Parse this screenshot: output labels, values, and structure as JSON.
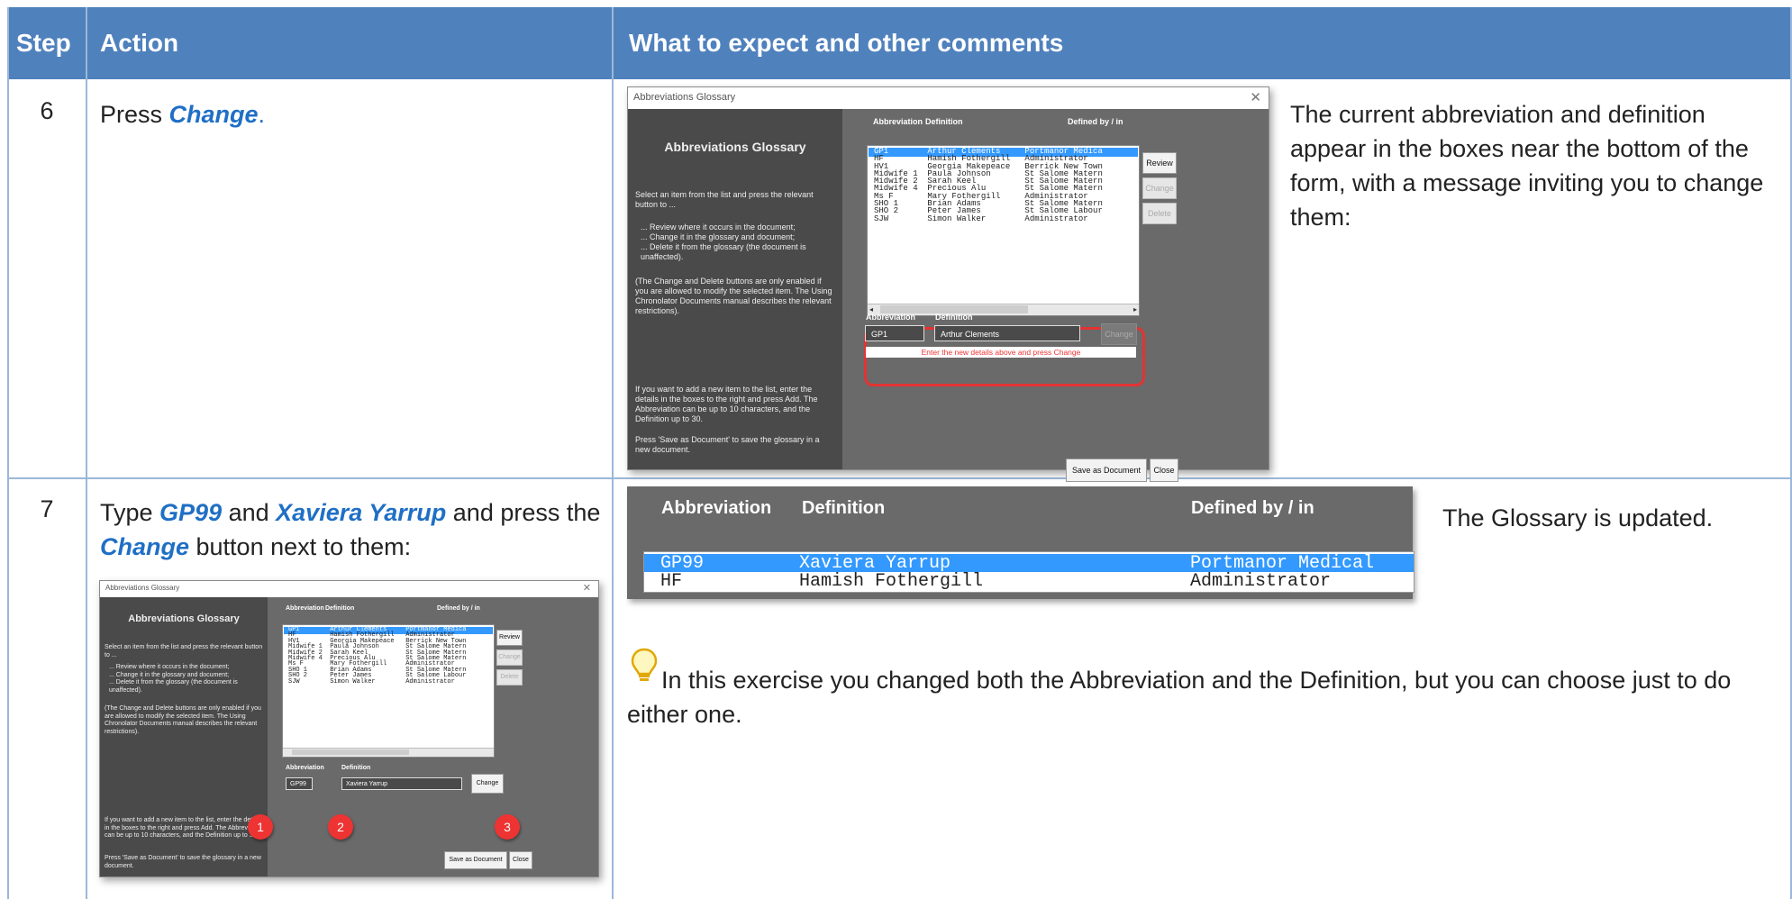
{
  "table": {
    "headers": {
      "step": "Step",
      "action": "Action",
      "expect": "What to expect and other comments"
    }
  },
  "rows": [
    {
      "step": "6",
      "action_pre": "Press ",
      "action_em": "Change",
      "action_post": ".",
      "comment": "The current abbreviation and definition appear in the boxes near the bottom of the form, with a message inviting you to change them:"
    },
    {
      "step": "7",
      "action_1": "Type ",
      "action_em1": "GP99",
      "action_2": " and ",
      "action_em2": "Xaviera Yarrup",
      "action_3": " and press the ",
      "action_em3": "Change",
      "action_4": " button next to them:",
      "comment": "The Glossary is updated.",
      "tip": "In this exercise you changed both the Abbreviation and the Definition, but you can choose just to do either one."
    }
  ],
  "dialog": {
    "window_title": "Abbreviations Glossary",
    "heading": "Abbreviations Glossary",
    "intro": "Select an item from the list and press the relevant button to ...",
    "bullets": [
      "... Review where it occurs in the document;",
      "... Change it in the glossary and document;",
      "... Delete it from the glossary (the document is unaffected)."
    ],
    "note": "(The Change and Delete buttons are only enabled if you are allowed to modify the selected item. The Using Chronolator Documents manual describes the relevant restrictions).",
    "add_help": "If you want to add a new item to the list, enter the details in the boxes to the right and press Add. The Abbreviation can be up to 10 characters, and the Definition up to 30.",
    "save_help": "Press 'Save as Document' to save the glossary in a new document.",
    "col_abbrev": "Abbreviation",
    "col_def": "Definition",
    "col_defined": "Defined by / in",
    "btn_review": "Review",
    "btn_change": "Change",
    "btn_delete": "Delete",
    "btn_save": "Save as Document",
    "btn_close": "Close",
    "entries": [
      {
        "abbr": "GP1",
        "def": "Arthur Clements",
        "by": "Portmanor Medica"
      },
      {
        "abbr": "HF",
        "def": "Hamish Fothergill",
        "by": "Administrator"
      },
      {
        "abbr": "HV1",
        "def": "Georgia Makepeace",
        "by": "Berrick New Town"
      },
      {
        "abbr": "Midwife 1",
        "def": "Paula Johnson",
        "by": "St Salome Matern"
      },
      {
        "abbr": "Midwife 2",
        "def": "Sarah Keel",
        "by": "St Salome Matern"
      },
      {
        "abbr": "Midwife 4",
        "def": "Precious Alu",
        "by": "St Salome Matern"
      },
      {
        "abbr": "Ms F",
        "def": "Mary Fothergill",
        "by": "Administrator"
      },
      {
        "abbr": "SHO 1",
        "def": "Brian Adams",
        "by": "St Salome Matern"
      },
      {
        "abbr": "SHO 2",
        "def": "Peter James",
        "by": "St Salome Labour"
      },
      {
        "abbr": "SJW",
        "def": "Simon Walker",
        "by": "Administrator"
      }
    ],
    "edit_abbr": "GP1",
    "edit_def": "Arthur Clements",
    "edit_msg": "Enter the new details above and press Change",
    "edit_abbr_2": "GP99",
    "edit_def_2": "Xaviera Yarrup",
    "markers": [
      "1",
      "2",
      "3"
    ]
  },
  "result": {
    "col_abbrev": "Abbreviation",
    "col_def": "Definition",
    "col_defined": "Defined by / in",
    "rows": [
      {
        "abbr": "GP99",
        "def": "Xaviera Yarrup",
        "by": "Portmanor Medical"
      },
      {
        "abbr": "HF",
        "def": "Hamish Fothergill",
        "by": "Administrator"
      }
    ]
  },
  "colors": {
    "header": "#4f81bd",
    "accent": "#1f6fc5",
    "highlight": "#e33333"
  },
  "icons": {
    "tip": "lightbulb-icon"
  }
}
